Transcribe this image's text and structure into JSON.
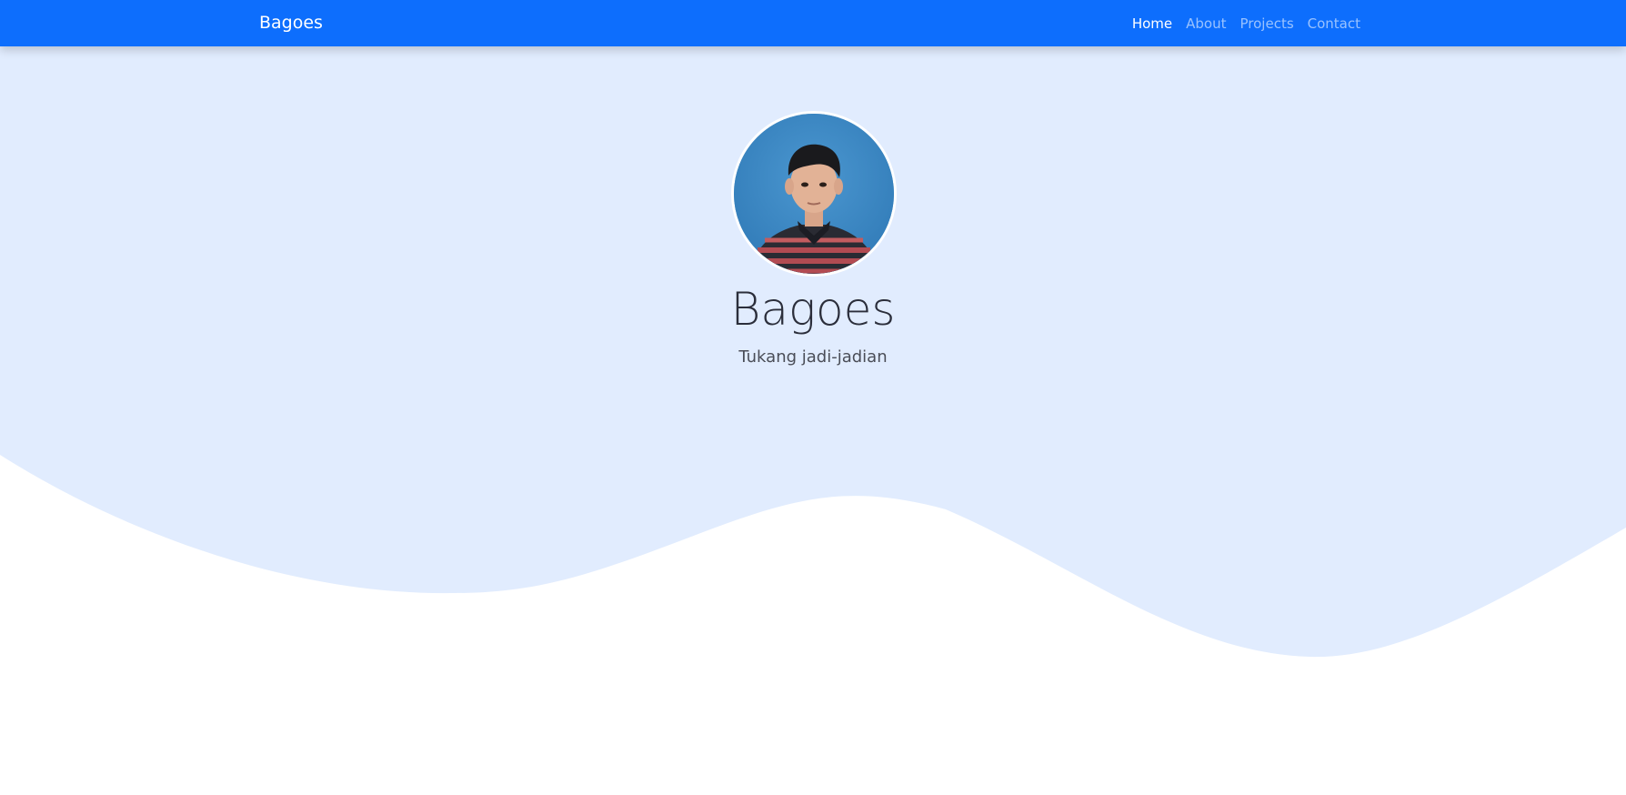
{
  "navbar": {
    "brand": "Bagoes",
    "links": [
      {
        "label": "Home",
        "active": true
      },
      {
        "label": "About",
        "active": false
      },
      {
        "label": "Projects",
        "active": false
      },
      {
        "label": "Contact",
        "active": false
      }
    ]
  },
  "hero": {
    "name": "Bagoes",
    "tagline": "Tukang jadi-jadian"
  },
  "colors": {
    "navbar": "#0d6efd",
    "hero_background": "#e1ecfe",
    "page_background": "#ffffff"
  }
}
